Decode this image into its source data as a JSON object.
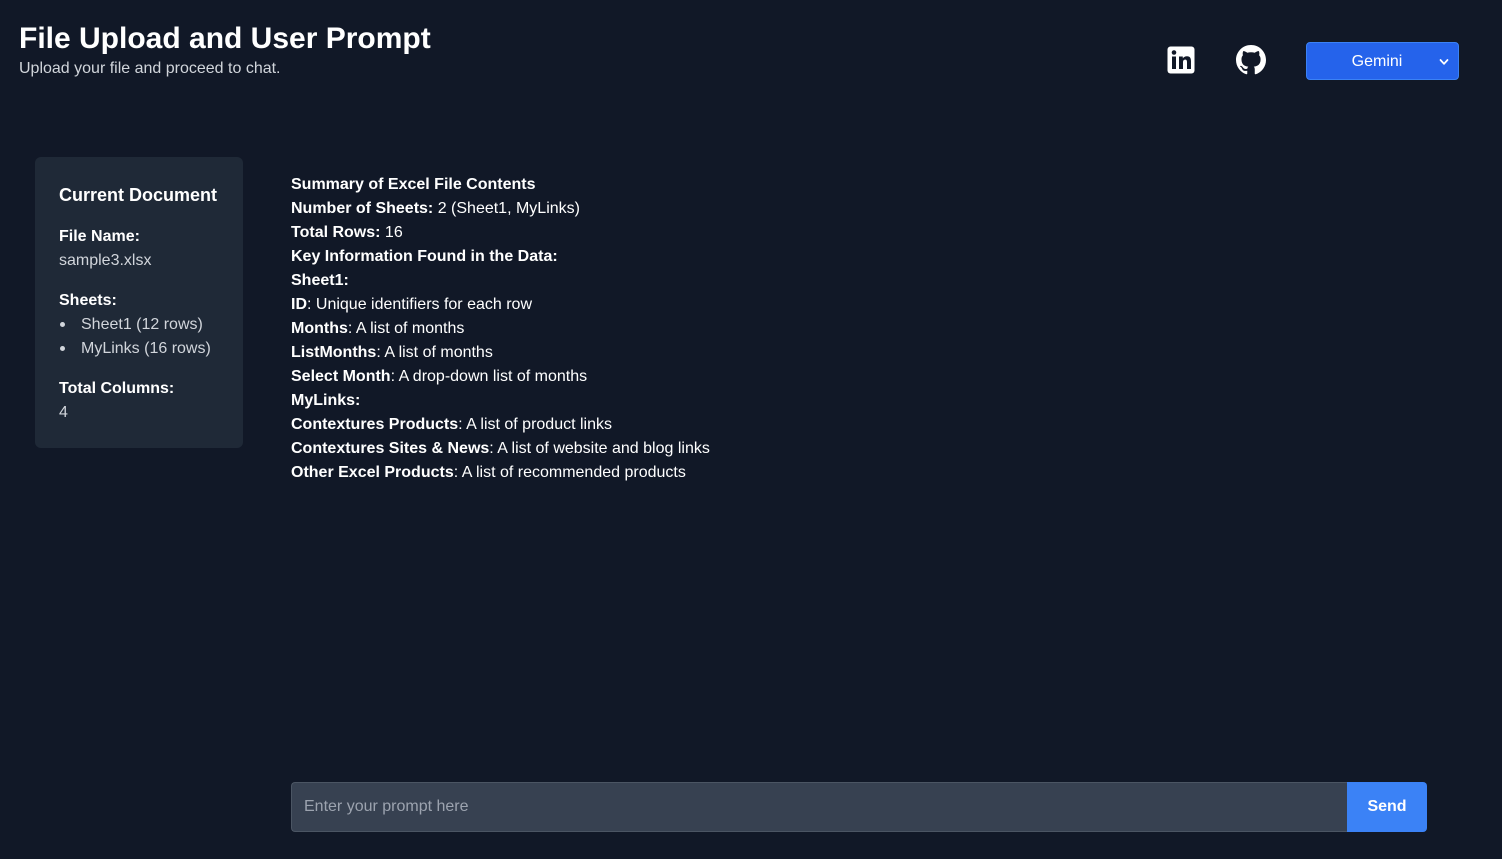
{
  "header": {
    "title": "File Upload and User Prompt",
    "subtitle": "Upload your file and proceed to chat."
  },
  "social": {
    "linkedin_icon": "linkedin-icon",
    "github_icon": "github-icon"
  },
  "model_select": {
    "selected": "Gemini"
  },
  "document": {
    "title": "Current Document",
    "file_name_label": "File Name:",
    "file_name": "sample3.xlsx",
    "sheets_label": "Sheets:",
    "sheets": [
      "Sheet1 (12 rows)",
      "MyLinks (16 rows)"
    ],
    "total_columns_label": "Total Columns:",
    "total_columns": "4"
  },
  "summary": {
    "lines": [
      {
        "bold": "Summary of Excel File Contents",
        "text": ""
      },
      {
        "bold": "Number of Sheets:",
        "text": " 2 (Sheet1, MyLinks)"
      },
      {
        "bold": "Total Rows:",
        "text": " 16"
      },
      {
        "bold": "Key Information Found in the Data:",
        "text": ""
      },
      {
        "bold": "Sheet1:",
        "text": ""
      },
      {
        "bold": "ID",
        "text": ": Unique identifiers for each row"
      },
      {
        "bold": "Months",
        "text": ": A list of months"
      },
      {
        "bold": "ListMonths",
        "text": ": A list of months"
      },
      {
        "bold": "Select Month",
        "text": ": A drop-down list of months"
      },
      {
        "bold": "MyLinks:",
        "text": ""
      },
      {
        "bold": "Contextures Products",
        "text": ": A list of product links"
      },
      {
        "bold": "Contextures Sites & News",
        "text": ": A list of website and blog links"
      },
      {
        "bold": "Other Excel Products",
        "text": ": A list of recommended products"
      }
    ]
  },
  "prompt": {
    "placeholder": "Enter your prompt here",
    "value": "",
    "send_label": "Send"
  },
  "colors": {
    "background": "#111827",
    "card": "#1f2937",
    "accent": "#2563eb",
    "send": "#3b82f6"
  }
}
